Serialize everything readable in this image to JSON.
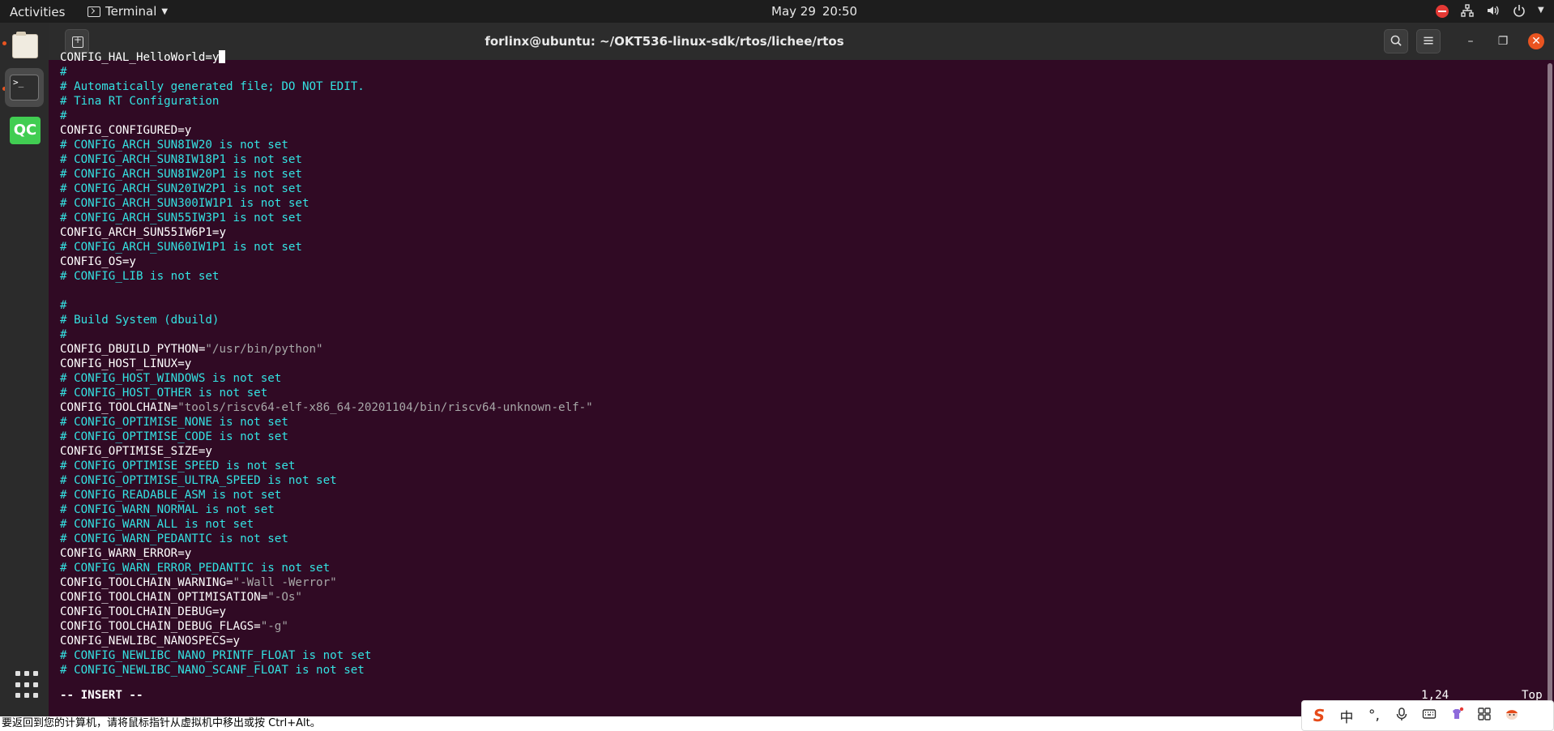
{
  "topbar": {
    "activities": "Activities",
    "app_menu": "Terminal",
    "date": "May 29",
    "time": "20:50"
  },
  "window": {
    "title": "forlinx@ubuntu: ~/OKT536-linux-sdk/rtos/lichee/rtos"
  },
  "dock": {
    "qc_label": "QC",
    "terminal_prompt": ">_"
  },
  "terminal": {
    "lines": [
      [
        {
          "t": "CONFIG_HAL_HelloWorld=y",
          "c": "cfg"
        },
        {
          "cursor": true
        }
      ],
      [
        {
          "t": "#",
          "c": "comment"
        }
      ],
      [
        {
          "t": "# Automatically generated file; DO NOT EDIT.",
          "c": "comment"
        }
      ],
      [
        {
          "t": "# Tina RT Configuration",
          "c": "comment"
        }
      ],
      [
        {
          "t": "#",
          "c": "comment"
        }
      ],
      [
        {
          "t": "CONFIG_CONFIGURED=y",
          "c": "cfg"
        }
      ],
      [
        {
          "t": "# CONFIG_ARCH_SUN8IW20 is not set",
          "c": "comment"
        }
      ],
      [
        {
          "t": "# CONFIG_ARCH_SUN8IW18P1 is not set",
          "c": "comment"
        }
      ],
      [
        {
          "t": "# CONFIG_ARCH_SUN8IW20P1 is not set",
          "c": "comment"
        }
      ],
      [
        {
          "t": "# CONFIG_ARCH_SUN20IW2P1 is not set",
          "c": "comment"
        }
      ],
      [
        {
          "t": "# CONFIG_ARCH_SUN300IW1P1 is not set",
          "c": "comment"
        }
      ],
      [
        {
          "t": "# CONFIG_ARCH_SUN55IW3P1 is not set",
          "c": "comment"
        }
      ],
      [
        {
          "t": "CONFIG_ARCH_SUN55IW6P1=y",
          "c": "cfg"
        }
      ],
      [
        {
          "t": "# CONFIG_ARCH_SUN60IW1P1 is not set",
          "c": "comment"
        }
      ],
      [
        {
          "t": "CONFIG_OS=y",
          "c": "cfg"
        }
      ],
      [
        {
          "t": "# CONFIG_LIB is not set",
          "c": "comment"
        }
      ],
      [
        {
          "t": "",
          "c": "cfg"
        }
      ],
      [
        {
          "t": "#",
          "c": "comment"
        }
      ],
      [
        {
          "t": "# Build System (dbuild)",
          "c": "comment"
        }
      ],
      [
        {
          "t": "#",
          "c": "comment"
        }
      ],
      [
        {
          "t": "CONFIG_DBUILD_PYTHON=",
          "c": "cfg"
        },
        {
          "t": "\"/usr/bin/python\"",
          "c": "str"
        }
      ],
      [
        {
          "t": "CONFIG_HOST_LINUX=y",
          "c": "cfg"
        }
      ],
      [
        {
          "t": "# CONFIG_HOST_WINDOWS is not set",
          "c": "comment"
        }
      ],
      [
        {
          "t": "# CONFIG_HOST_OTHER is not set",
          "c": "comment"
        }
      ],
      [
        {
          "t": "CONFIG_TOOLCHAIN=",
          "c": "cfg"
        },
        {
          "t": "\"tools/riscv64-elf-x86_64-20201104/bin/riscv64-unknown-elf-\"",
          "c": "str"
        }
      ],
      [
        {
          "t": "# CONFIG_OPTIMISE_NONE is not set",
          "c": "comment"
        }
      ],
      [
        {
          "t": "# CONFIG_OPTIMISE_CODE is not set",
          "c": "comment"
        }
      ],
      [
        {
          "t": "CONFIG_OPTIMISE_SIZE=y",
          "c": "cfg"
        }
      ],
      [
        {
          "t": "# CONFIG_OPTIMISE_SPEED is not set",
          "c": "comment"
        }
      ],
      [
        {
          "t": "# CONFIG_OPTIMISE_ULTRA_SPEED is not set",
          "c": "comment"
        }
      ],
      [
        {
          "t": "# CONFIG_READABLE_ASM is not set",
          "c": "comment"
        }
      ],
      [
        {
          "t": "# CONFIG_WARN_NORMAL is not set",
          "c": "comment"
        }
      ],
      [
        {
          "t": "# CONFIG_WARN_ALL is not set",
          "c": "comment"
        }
      ],
      [
        {
          "t": "# CONFIG_WARN_PEDANTIC is not set",
          "c": "comment"
        }
      ],
      [
        {
          "t": "CONFIG_WARN_ERROR=y",
          "c": "cfg"
        }
      ],
      [
        {
          "t": "# CONFIG_WARN_ERROR_PEDANTIC is not set",
          "c": "comment"
        }
      ],
      [
        {
          "t": "CONFIG_TOOLCHAIN_WARNING=",
          "c": "cfg"
        },
        {
          "t": "\"-Wall -Werror\"",
          "c": "str"
        }
      ],
      [
        {
          "t": "CONFIG_TOOLCHAIN_OPTIMISATION=",
          "c": "cfg"
        },
        {
          "t": "\"-Os\"",
          "c": "str"
        }
      ],
      [
        {
          "t": "CONFIG_TOOLCHAIN_DEBUG=y",
          "c": "cfg"
        }
      ],
      [
        {
          "t": "CONFIG_TOOLCHAIN_DEBUG_FLAGS=",
          "c": "cfg"
        },
        {
          "t": "\"-g\"",
          "c": "str"
        }
      ],
      [
        {
          "t": "CONFIG_NEWLIBC_NANOSPECS=y",
          "c": "cfg"
        }
      ],
      [
        {
          "t": "# CONFIG_NEWLIBC_NANO_PRINTF_FLOAT is not set",
          "c": "comment"
        }
      ],
      [
        {
          "t": "# CONFIG_NEWLIBC_NANO_SCANF_FLOAT is not set",
          "c": "comment"
        }
      ]
    ],
    "mode": "-- INSERT --",
    "cursor_pos": "1,24",
    "scroll_pos": "Top"
  },
  "vm_hint": "要返回到您的计算机，请将鼠标指针从虚拟机中移出或按 Ctrl+Alt。",
  "ime": {
    "logo": "S",
    "lang": "中",
    "punct": "°,"
  },
  "colors": {
    "terminal_bg": "#300a24",
    "comment": "#34e2e2",
    "string": "#a7a7a7",
    "accent": "#e95420"
  }
}
